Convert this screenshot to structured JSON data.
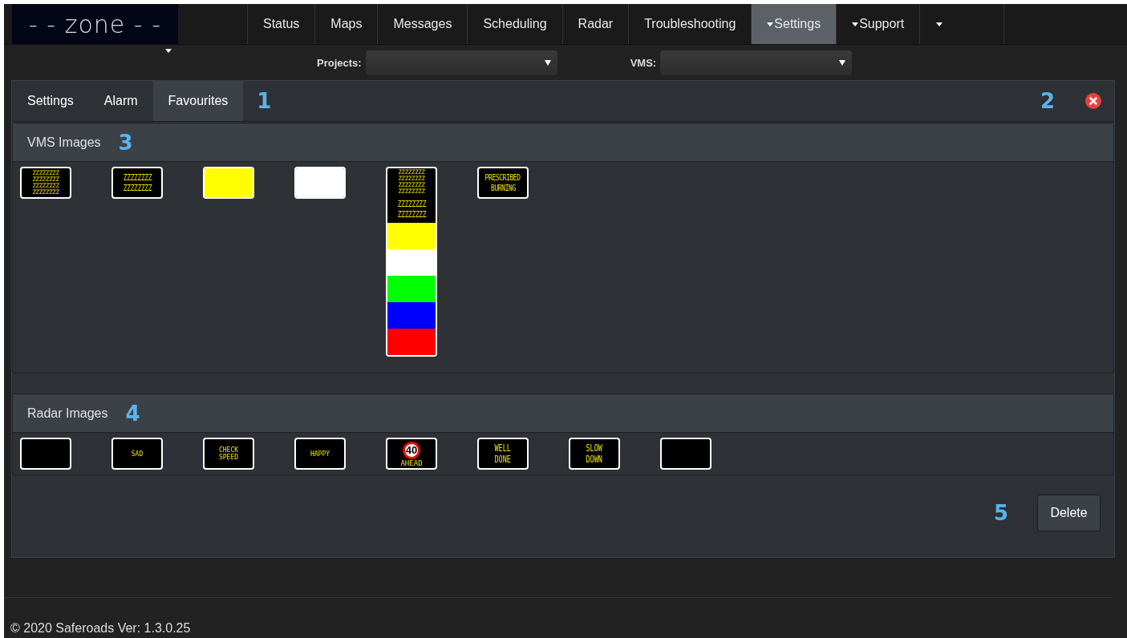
{
  "logo": {
    "text": "- - zone - -"
  },
  "nav": [
    {
      "label": "Status",
      "selected": false,
      "dropdown": false
    },
    {
      "label": "Maps",
      "selected": false,
      "dropdown": false
    },
    {
      "label": "Messages",
      "selected": false,
      "dropdown": false
    },
    {
      "label": "Scheduling",
      "selected": false,
      "dropdown": false
    },
    {
      "label": "Radar",
      "selected": false,
      "dropdown": false
    },
    {
      "label": "Troubleshooting",
      "selected": false,
      "dropdown": false
    },
    {
      "label": "Settings",
      "selected": true,
      "dropdown": true
    },
    {
      "label": "Support",
      "selected": false,
      "dropdown": true
    },
    {
      "selected": false,
      "dropdown": true
    }
  ],
  "filters": [
    {
      "label": "Projects:"
    },
    {
      "label": "VMS:"
    }
  ],
  "tabs": [
    {
      "label": "Settings",
      "selected": false
    },
    {
      "label": "Alarm",
      "selected": false
    },
    {
      "label": "Favourites",
      "selected": true
    }
  ],
  "callouts": [
    "1",
    "2",
    "3",
    "4",
    "5"
  ],
  "vms_panel": {
    "title": "VMS Images"
  },
  "vms_images": [
    {
      "kind": "dense-text",
      "lines": [
        "ZZZZZZZZ",
        "ZZZZZZZZ",
        "ZZZZZZZZ",
        "ZZZZZZZZ"
      ]
    },
    {
      "kind": "text",
      "lines": [
        "ZZZZZZZZ",
        "ZZZZZZZZ"
      ]
    },
    {
      "kind": "fill",
      "color": "#ffff00"
    },
    {
      "kind": "fill",
      "color": "#ffffff"
    },
    {
      "kind": "stack",
      "segments": [
        {
          "kind": "dense-text",
          "lines": [
            "ZZZZZZZZ",
            "ZZZZZZZZ",
            "ZZZZZZZZ",
            "ZZZZZZZZ"
          ]
        },
        {
          "kind": "text",
          "lines": [
            "ZZZZZZZZ",
            "ZZZZZZZZ"
          ]
        },
        {
          "kind": "fill",
          "color": "#ffff00"
        },
        {
          "kind": "fill",
          "color": "#ffffff"
        },
        {
          "kind": "fill",
          "color": "#00ff00"
        },
        {
          "kind": "fill",
          "color": "#0000ff"
        },
        {
          "kind": "fill",
          "color": "#ff0000"
        }
      ]
    },
    {
      "kind": "text",
      "lines": [
        "PRESCRIBED",
        "BURNING"
      ]
    }
  ],
  "radar_panel": {
    "title": "Radar Images"
  },
  "radar_images": [
    {
      "kind": "blank"
    },
    {
      "kind": "small-text",
      "lines": [
        "SAD"
      ]
    },
    {
      "kind": "small-text",
      "lines": [
        "CHECK",
        "SPEED"
      ]
    },
    {
      "kind": "small-text",
      "lines": [
        "HAPPY"
      ]
    },
    {
      "kind": "speed",
      "limit": "40",
      "lines": [
        "AHEAD"
      ]
    },
    {
      "kind": "large-text",
      "lines": [
        "WELL",
        "DONE"
      ]
    },
    {
      "kind": "large-text",
      "lines": [
        "SLOW",
        "DOWN"
      ]
    },
    {
      "kind": "blank"
    }
  ],
  "delete_button": {
    "label": "Delete"
  },
  "footer": {
    "text": "© 2020 Saferoads Ver: 1.3.0.25"
  }
}
